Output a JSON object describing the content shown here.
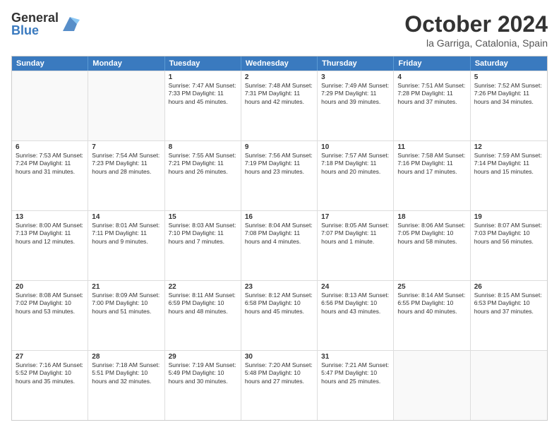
{
  "logo": {
    "general": "General",
    "blue": "Blue"
  },
  "header": {
    "month": "October 2024",
    "location": "la Garriga, Catalonia, Spain"
  },
  "weekdays": [
    "Sunday",
    "Monday",
    "Tuesday",
    "Wednesday",
    "Thursday",
    "Friday",
    "Saturday"
  ],
  "rows": [
    [
      {
        "day": "",
        "info": "",
        "empty": true
      },
      {
        "day": "",
        "info": "",
        "empty": true
      },
      {
        "day": "1",
        "info": "Sunrise: 7:47 AM\nSunset: 7:33 PM\nDaylight: 11 hours and 45 minutes."
      },
      {
        "day": "2",
        "info": "Sunrise: 7:48 AM\nSunset: 7:31 PM\nDaylight: 11 hours and 42 minutes."
      },
      {
        "day": "3",
        "info": "Sunrise: 7:49 AM\nSunset: 7:29 PM\nDaylight: 11 hours and 39 minutes."
      },
      {
        "day": "4",
        "info": "Sunrise: 7:51 AM\nSunset: 7:28 PM\nDaylight: 11 hours and 37 minutes."
      },
      {
        "day": "5",
        "info": "Sunrise: 7:52 AM\nSunset: 7:26 PM\nDaylight: 11 hours and 34 minutes."
      }
    ],
    [
      {
        "day": "6",
        "info": "Sunrise: 7:53 AM\nSunset: 7:24 PM\nDaylight: 11 hours and 31 minutes."
      },
      {
        "day": "7",
        "info": "Sunrise: 7:54 AM\nSunset: 7:23 PM\nDaylight: 11 hours and 28 minutes."
      },
      {
        "day": "8",
        "info": "Sunrise: 7:55 AM\nSunset: 7:21 PM\nDaylight: 11 hours and 26 minutes."
      },
      {
        "day": "9",
        "info": "Sunrise: 7:56 AM\nSunset: 7:19 PM\nDaylight: 11 hours and 23 minutes."
      },
      {
        "day": "10",
        "info": "Sunrise: 7:57 AM\nSunset: 7:18 PM\nDaylight: 11 hours and 20 minutes."
      },
      {
        "day": "11",
        "info": "Sunrise: 7:58 AM\nSunset: 7:16 PM\nDaylight: 11 hours and 17 minutes."
      },
      {
        "day": "12",
        "info": "Sunrise: 7:59 AM\nSunset: 7:14 PM\nDaylight: 11 hours and 15 minutes."
      }
    ],
    [
      {
        "day": "13",
        "info": "Sunrise: 8:00 AM\nSunset: 7:13 PM\nDaylight: 11 hours and 12 minutes."
      },
      {
        "day": "14",
        "info": "Sunrise: 8:01 AM\nSunset: 7:11 PM\nDaylight: 11 hours and 9 minutes."
      },
      {
        "day": "15",
        "info": "Sunrise: 8:03 AM\nSunset: 7:10 PM\nDaylight: 11 hours and 7 minutes."
      },
      {
        "day": "16",
        "info": "Sunrise: 8:04 AM\nSunset: 7:08 PM\nDaylight: 11 hours and 4 minutes."
      },
      {
        "day": "17",
        "info": "Sunrise: 8:05 AM\nSunset: 7:07 PM\nDaylight: 11 hours and 1 minute."
      },
      {
        "day": "18",
        "info": "Sunrise: 8:06 AM\nSunset: 7:05 PM\nDaylight: 10 hours and 58 minutes."
      },
      {
        "day": "19",
        "info": "Sunrise: 8:07 AM\nSunset: 7:03 PM\nDaylight: 10 hours and 56 minutes."
      }
    ],
    [
      {
        "day": "20",
        "info": "Sunrise: 8:08 AM\nSunset: 7:02 PM\nDaylight: 10 hours and 53 minutes."
      },
      {
        "day": "21",
        "info": "Sunrise: 8:09 AM\nSunset: 7:00 PM\nDaylight: 10 hours and 51 minutes."
      },
      {
        "day": "22",
        "info": "Sunrise: 8:11 AM\nSunset: 6:59 PM\nDaylight: 10 hours and 48 minutes."
      },
      {
        "day": "23",
        "info": "Sunrise: 8:12 AM\nSunset: 6:58 PM\nDaylight: 10 hours and 45 minutes."
      },
      {
        "day": "24",
        "info": "Sunrise: 8:13 AM\nSunset: 6:56 PM\nDaylight: 10 hours and 43 minutes."
      },
      {
        "day": "25",
        "info": "Sunrise: 8:14 AM\nSunset: 6:55 PM\nDaylight: 10 hours and 40 minutes."
      },
      {
        "day": "26",
        "info": "Sunrise: 8:15 AM\nSunset: 6:53 PM\nDaylight: 10 hours and 37 minutes."
      }
    ],
    [
      {
        "day": "27",
        "info": "Sunrise: 7:16 AM\nSunset: 5:52 PM\nDaylight: 10 hours and 35 minutes."
      },
      {
        "day": "28",
        "info": "Sunrise: 7:18 AM\nSunset: 5:51 PM\nDaylight: 10 hours and 32 minutes."
      },
      {
        "day": "29",
        "info": "Sunrise: 7:19 AM\nSunset: 5:49 PM\nDaylight: 10 hours and 30 minutes."
      },
      {
        "day": "30",
        "info": "Sunrise: 7:20 AM\nSunset: 5:48 PM\nDaylight: 10 hours and 27 minutes."
      },
      {
        "day": "31",
        "info": "Sunrise: 7:21 AM\nSunset: 5:47 PM\nDaylight: 10 hours and 25 minutes."
      },
      {
        "day": "",
        "info": "",
        "empty": true
      },
      {
        "day": "",
        "info": "",
        "empty": true
      }
    ]
  ]
}
